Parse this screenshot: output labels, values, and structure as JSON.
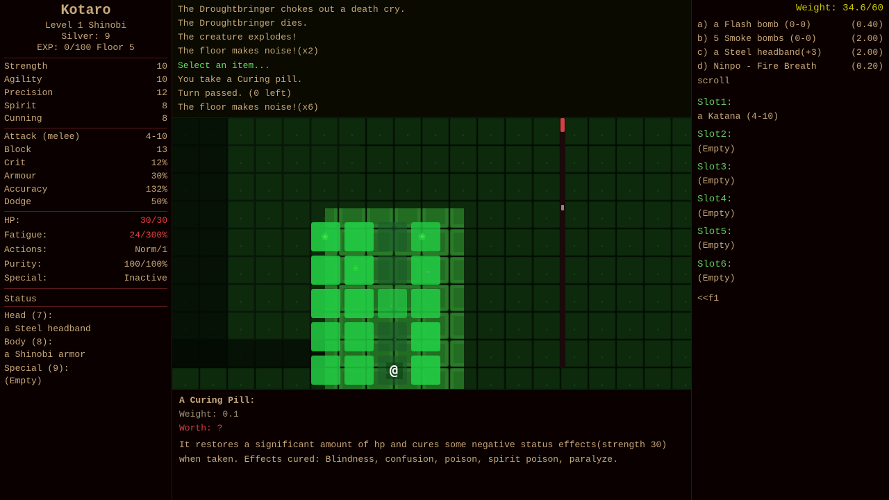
{
  "character": {
    "name": "Kotaro",
    "title": "Level 1 Shinobi",
    "silver": "Silver: 9",
    "expfloor": "EXP: 0/100   Floor 5",
    "stats": [
      {
        "label": "Strength",
        "value": "10"
      },
      {
        "label": "Agility",
        "value": "10"
      },
      {
        "label": "Precision",
        "value": "12"
      },
      {
        "label": "Spirit",
        "value": "8"
      },
      {
        "label": "Cunning",
        "value": "8"
      }
    ],
    "combat_stats": [
      {
        "label": "Attack (melee)",
        "value": "4-10"
      },
      {
        "label": "Block",
        "value": "13"
      },
      {
        "label": "Crit",
        "value": "12%"
      },
      {
        "label": "Armour",
        "value": "30%"
      },
      {
        "label": "Accuracy",
        "value": "132%"
      },
      {
        "label": "Dodge",
        "value": "50%"
      }
    ],
    "hp_label": "HP:",
    "hp_val": "30/30",
    "fatigue_label": "Fatigue:",
    "fatigue_val": "24/300%",
    "actions_label": "Actions:",
    "actions_val": "Norm/1",
    "purity_label": "Purity:",
    "purity_val": "100/100%",
    "special_label": "Special:",
    "special_val": "Inactive",
    "status_label": "Status",
    "equipment": [
      {
        "slot": "Head (7):",
        "item": "a Steel headband"
      },
      {
        "slot": "Body (8):",
        "item": "a Shinobi armor"
      },
      {
        "slot": "Special (9):",
        "item": "(Empty)"
      }
    ]
  },
  "log": {
    "lines": [
      {
        "text": "The Droughtbringer chokes out a death cry.",
        "class": "normal"
      },
      {
        "text": "The Droughtbringer dies.",
        "class": "normal"
      },
      {
        "text": "The creature explodes!",
        "class": "normal"
      },
      {
        "text": "The floor makes noise!(x2)",
        "class": "normal"
      },
      {
        "text": "Select an item...",
        "class": "highlight"
      },
      {
        "text": "You take a Curing pill.",
        "class": "normal"
      },
      {
        "text": "Turn passed. (0 left)",
        "class": "normal"
      },
      {
        "text": "The floor makes noise!(x6)",
        "class": "normal"
      }
    ]
  },
  "item_info": {
    "title": "A Curing Pill:",
    "weight": "Weight: 0.1",
    "worth": "Worth: ?",
    "desc": "  It restores a significant amount of hp and cures some negative status effects(strength 30) when taken. Effects cured: Blindness, confusion, poison, spirit poison, paralyze."
  },
  "inventory": {
    "weight_label": "Weight: 34.6/60",
    "items": [
      {
        "key": "a)",
        "name": "a Flash bomb (0-0)",
        "weight": "(0.40)"
      },
      {
        "key": "b)",
        "name": "5 Smoke bombs (0-0)",
        "weight": "(2.00)"
      },
      {
        "key": "c)",
        "name": "a Steel headband(+3)",
        "weight": "(2.00)"
      },
      {
        "key": "d)",
        "name": "Ninpo - Fire Breath scroll",
        "weight": "(0.20)"
      }
    ],
    "slots": [
      {
        "label": "Slot1:",
        "value": "a Katana (4-10)"
      },
      {
        "label": "Slot2:",
        "value": "(Empty)"
      },
      {
        "label": "Slot3:",
        "value": "(Empty)"
      },
      {
        "label": "Slot4:",
        "value": "(Empty)"
      },
      {
        "label": "Slot5:",
        "value": "(Empty)"
      },
      {
        "label": "Slot6:",
        "value": "(Empty)"
      }
    ],
    "ff_label": "<<f1"
  }
}
